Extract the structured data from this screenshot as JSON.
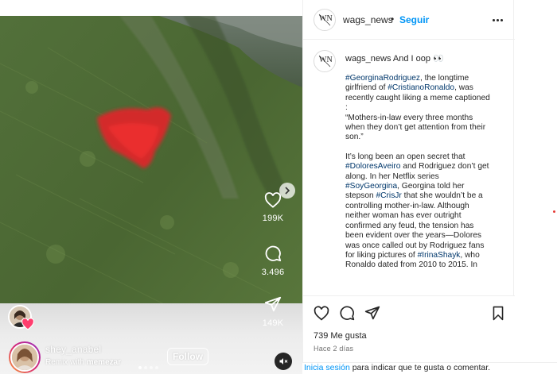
{
  "post": {
    "account": "wags_news",
    "follow_label": "Seguir",
    "separator": "•",
    "logo_initials": "WN"
  },
  "caption": {
    "head_text": "wags_news And I oop 👀",
    "paragraphs": [
      [
        {
          "t": "#GeorginaRodriguez",
          "tag": true
        },
        {
          "t": ", the longtime girlfriend of "
        },
        {
          "t": "#CristianoRonaldo",
          "tag": true
        },
        {
          "t": ", was recently caught liking a meme captioned :"
        },
        {
          "br": true
        },
        {
          "t": "“Mothers-in-law every three months when they don’t get attention from their son.”"
        }
      ],
      [
        {
          "t": "It’s long been an open secret that "
        },
        {
          "t": "#DoloresAveiro",
          "tag": true
        },
        {
          "t": " and Rodriguez don’t get along. In her Netflix series "
        },
        {
          "t": "#SoyGeorgina",
          "tag": true
        },
        {
          "t": ", Georgina told her stepson "
        },
        {
          "t": "#CrisJr",
          "tag": true
        },
        {
          "t": " that she wouldn’t be a controlling mother-in-law. Although neither woman has ever outright confirmed any feud, the tension has been evident over the years—Dolores was once called out by Rodriguez fans for liking pictures of "
        },
        {
          "t": "#IrinaShayk",
          "tag": true
        },
        {
          "t": ", who Ronaldo dated from 2010 to 2015. In"
        }
      ]
    ]
  },
  "stats": {
    "likes": "739 Me gusta",
    "time": "Hace 2 días"
  },
  "reel": {
    "like_count": "199K",
    "comment_count": "3.496",
    "share_count": "149K",
    "username": "shey_anabel",
    "remix_prefix": "Remix with",
    "remix_user": "memezar",
    "follow_label": "Follow",
    "page_dots": 4,
    "active_dot": 0
  },
  "login_prompt": {
    "link": "Inicia sesión",
    "rest": " para indicar que te gusta o comentar."
  },
  "colors": {
    "accent_blue": "#0095f6",
    "hashtag": "#00376b",
    "text": "#262626",
    "muted": "#737373",
    "grass": "#3e5a2e",
    "dress_red": "#d32b2b"
  },
  "icons": {
    "like": "heart-icon",
    "comment": "comment-icon",
    "share": "paper-plane-icon",
    "save": "bookmark-icon",
    "more": "more-dots-icon",
    "mute": "muted-speaker-icon",
    "next": "chevron-right-icon"
  }
}
